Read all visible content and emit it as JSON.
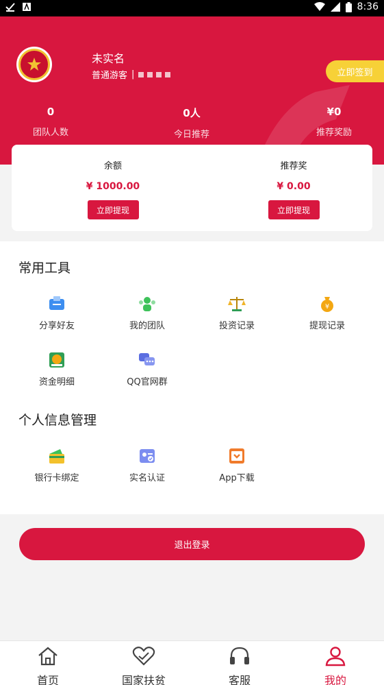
{
  "status_bar": {
    "time": "8:36"
  },
  "header": {
    "user_name": "未实名",
    "user_role": "普通游客",
    "role_separator": "|",
    "signin_label": "立即签到",
    "stats": [
      {
        "value": "0",
        "label": "团队人数"
      },
      {
        "value": "0人",
        "label": "今日推荐"
      },
      {
        "value": "¥0",
        "label": "推荐奖励"
      }
    ]
  },
  "balance": {
    "balance_label": "余额",
    "balance_amount": "¥ 1000.00",
    "reward_label": "推荐奖",
    "reward_amount": "¥ 0.00",
    "withdraw_label": "立即提现"
  },
  "tools": {
    "title": "常用工具",
    "items": [
      {
        "label": "分享好友",
        "icon": "share-icon"
      },
      {
        "label": "我的团队",
        "icon": "team-icon"
      },
      {
        "label": "投资记录",
        "icon": "scale-icon"
      },
      {
        "label": "提现记录",
        "icon": "money-bag-icon"
      },
      {
        "label": "资金明细",
        "icon": "fund-detail-icon"
      },
      {
        "label": "QQ官网群",
        "icon": "chat-icon"
      }
    ]
  },
  "personal": {
    "title": "个人信息管理",
    "items": [
      {
        "label": "银行卡绑定",
        "icon": "bank-card-icon"
      },
      {
        "label": "实名认证",
        "icon": "id-card-icon"
      },
      {
        "label": "App下载",
        "icon": "download-icon"
      }
    ]
  },
  "logout_label": "退出登录",
  "nav": [
    {
      "label": "首页",
      "icon": "home-icon"
    },
    {
      "label": "国家扶贫",
      "icon": "heart-icon"
    },
    {
      "label": "客服",
      "icon": "headset-icon"
    },
    {
      "label": "我的",
      "icon": "user-icon",
      "active": true
    }
  ],
  "colors": {
    "primary": "#d8173f",
    "signin": "#f7d137"
  }
}
